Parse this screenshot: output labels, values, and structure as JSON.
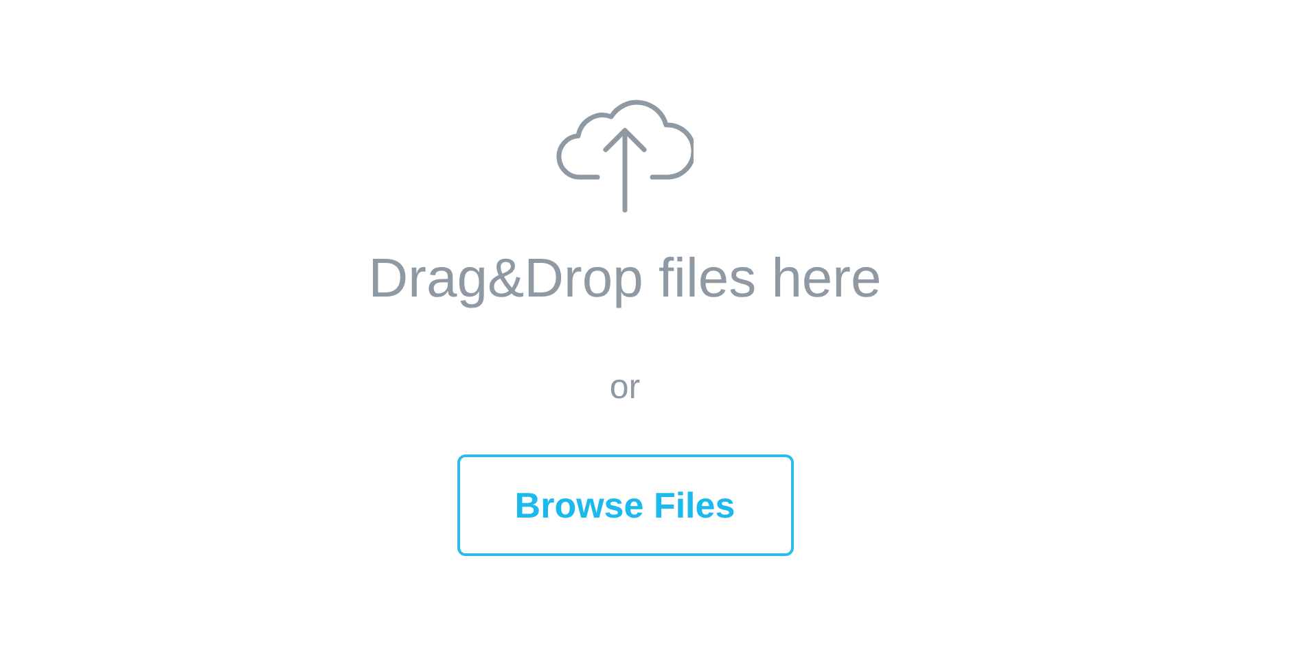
{
  "dropzone": {
    "title": "Drag&Drop files here",
    "separator": "or",
    "button": "Browse Files"
  }
}
